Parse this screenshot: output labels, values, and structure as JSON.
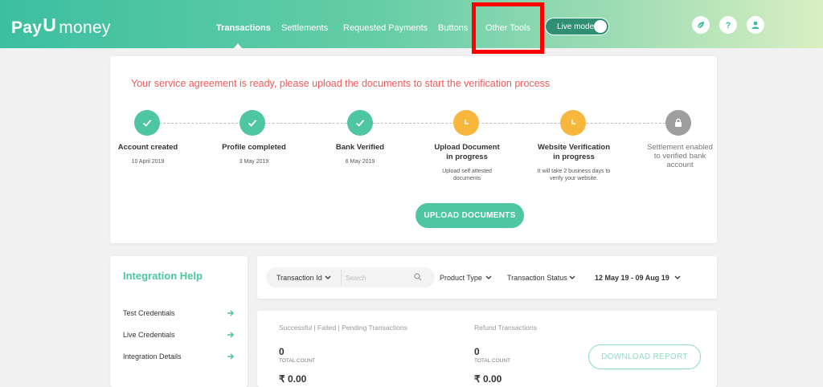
{
  "header": {
    "logo_left": "Pay",
    "logo_mark": "U",
    "logo_right": "money",
    "nav": [
      {
        "label": "Transactions",
        "active": true
      },
      {
        "label": "Settlements",
        "active": false
      },
      {
        "label": "Requested Payments",
        "active": false
      },
      {
        "label": "Buttons",
        "active": false
      },
      {
        "label": "Other Tools",
        "active": false
      }
    ],
    "live_mode_label": "Live mode",
    "live_mode_on": true,
    "icons": [
      "leaf-icon",
      "help-icon",
      "user-icon"
    ]
  },
  "agreement": {
    "message": "Your service agreement is ready, please upload the documents to start the verification process",
    "steps": [
      {
        "title": "Account created",
        "title2": "",
        "sub": "10 April 2019",
        "sub2": "",
        "status": "done"
      },
      {
        "title": "Profile completed",
        "title2": "",
        "sub": "3 May 2019",
        "sub2": "",
        "status": "done"
      },
      {
        "title": "Bank Verified",
        "title2": "",
        "sub": "6 May 2019",
        "sub2": "",
        "status": "done"
      },
      {
        "title": "Upload Document",
        "title2": "in progress",
        "sub": "Upload self attested",
        "sub2": "documents",
        "status": "in-progress"
      },
      {
        "title": "Website Verification",
        "title2": "in progress",
        "sub": "It will take 2 business days to",
        "sub2": "verify your website.",
        "status": "in-progress"
      },
      {
        "title": "Settlement enabled",
        "title2": "to verified bank",
        "title3": "account",
        "status": "locked"
      }
    ],
    "upload_button": "UPLOAD DOCUMENTS"
  },
  "integration_help": {
    "title": "Integration Help",
    "items": [
      "Test Credentials",
      "Live Credentials",
      "Integration Details"
    ]
  },
  "filters": {
    "search_by": "Transaction Id",
    "search_placeholder": "Search",
    "product_type": "Product Type",
    "transaction_status": "Transaction Status",
    "date_range": "12 May 19 - 09 Aug 19"
  },
  "summary": {
    "left_heading": "Successful | Failed | Pending Transactions",
    "right_heading": "Refund Transactions",
    "left_count": "0",
    "right_count": "0",
    "count_label": "TOTAL COUNT",
    "left_amount": "₹ 0.00",
    "right_amount": "₹ 0.00",
    "download_button": "DOWNLOAD REPORT"
  },
  "colors": {
    "accent": "#4ec6a2",
    "warning": "#f6b73c",
    "error_text": "#f05a5a",
    "highlight": "#ff0000"
  }
}
